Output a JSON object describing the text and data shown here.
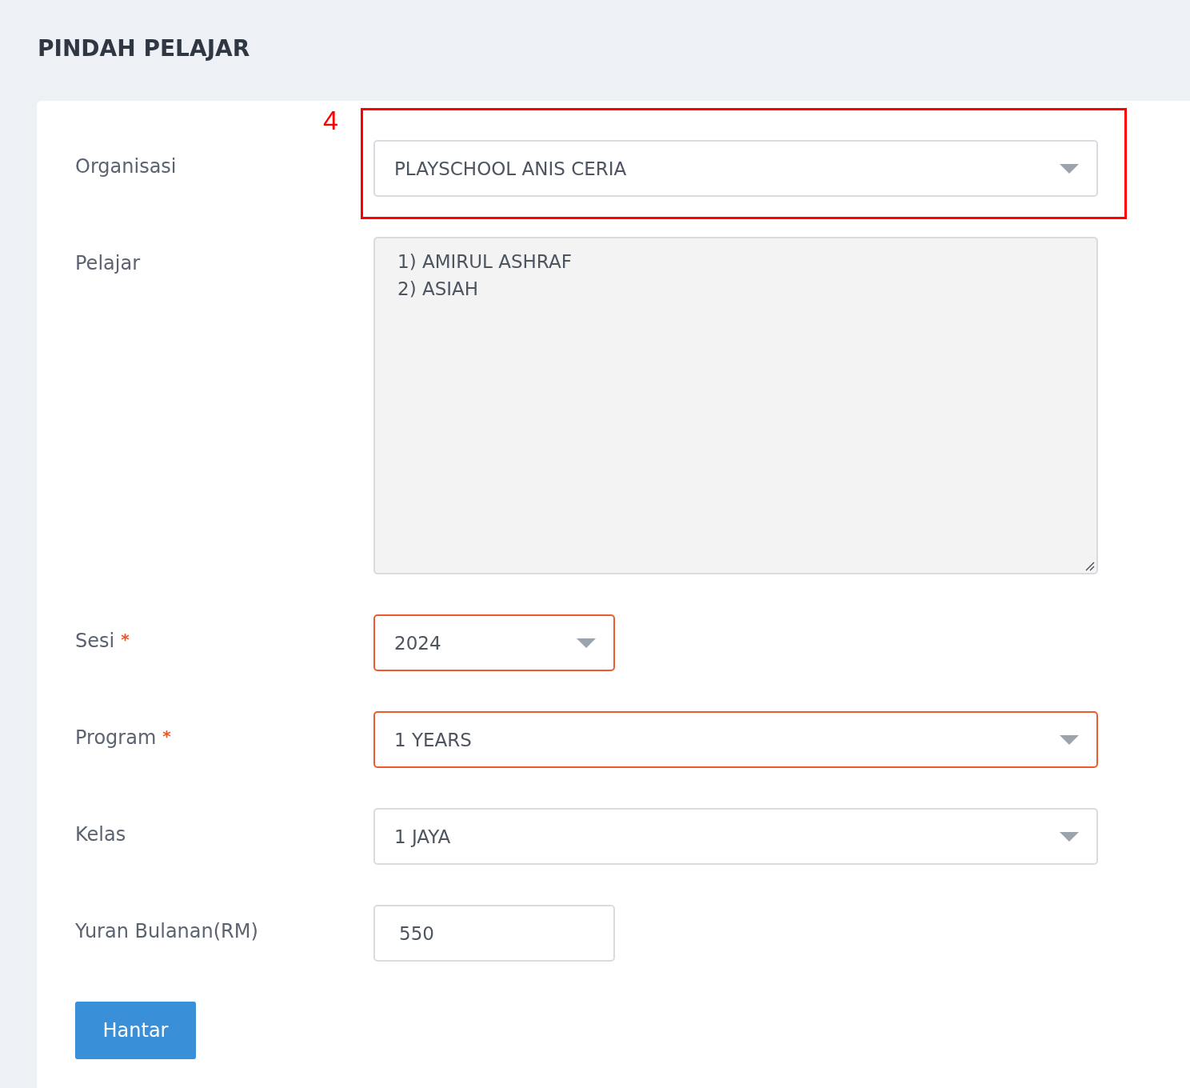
{
  "page_title": "PINDAH PELAJAR",
  "fields": [
    {
      "kind": "select",
      "label": "Organisasi",
      "required": false,
      "value": "PLAYSCHOOL ANIS CERIA",
      "wide": true,
      "annotation": {
        "label": "4"
      }
    },
    {
      "kind": "textarea",
      "label": "Pelajar",
      "required": false,
      "disabled": true,
      "lines": [
        "1) AMIRUL ASHRAF",
        "2) ASIAH"
      ]
    },
    {
      "kind": "select",
      "label": "Sesi",
      "required": true,
      "asterisk": "*",
      "value": "2024",
      "wide": false
    },
    {
      "kind": "select",
      "label": "Program",
      "required": true,
      "asterisk": "*",
      "value": "1 YEARS",
      "wide": true
    },
    {
      "kind": "select",
      "label": "Kelas",
      "required": false,
      "value": "1 JAYA",
      "wide": true
    },
    {
      "kind": "input",
      "label": "Yuran Bulanan(RM)",
      "required": false,
      "value": "550",
      "wide": false
    }
  ],
  "submit_button": "Hantar"
}
